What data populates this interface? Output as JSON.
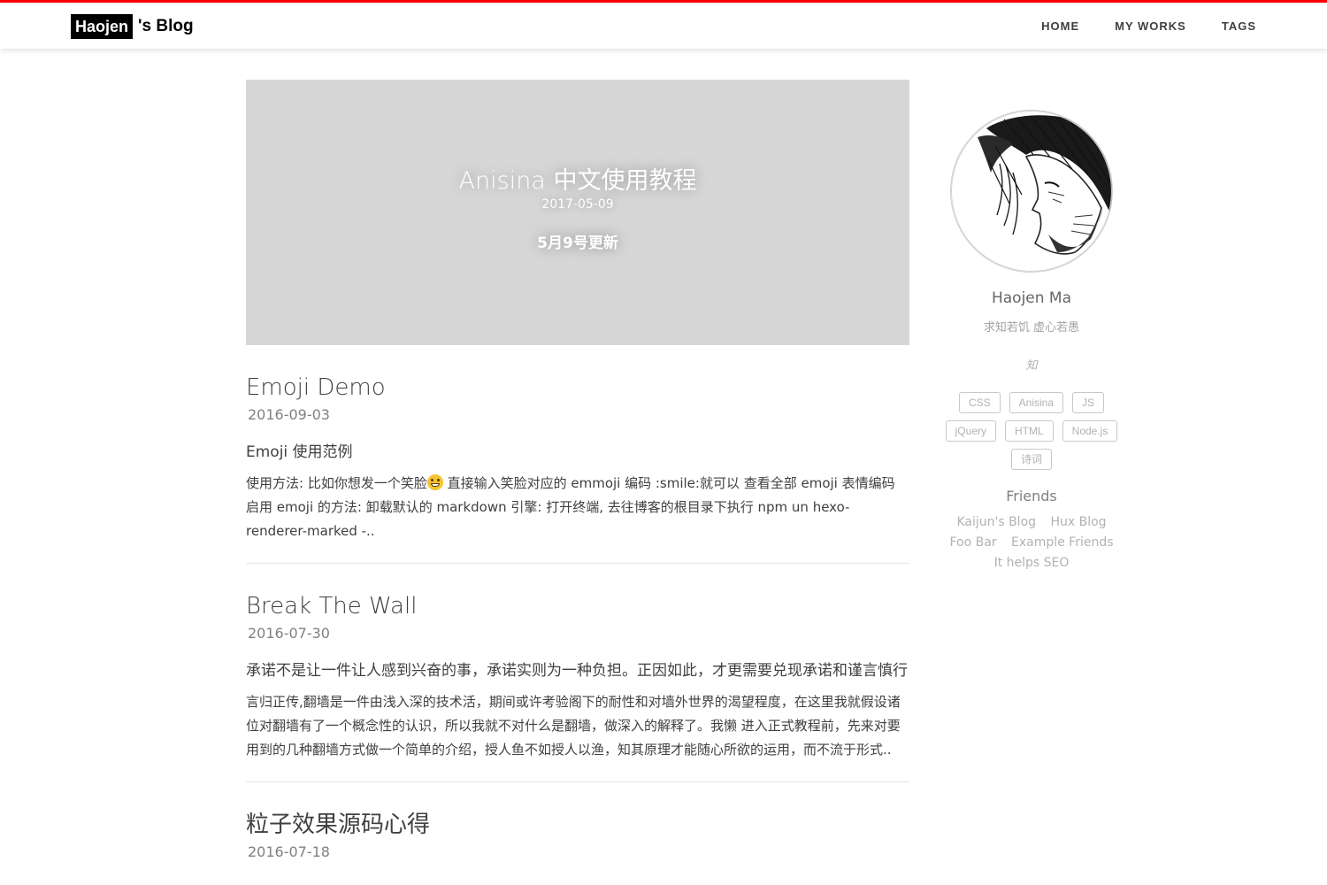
{
  "navbar": {
    "brand_name": "Haojen",
    "brand_suffix": "'s Blog",
    "accent_color": "#f90000",
    "links": [
      {
        "label": "HOME"
      },
      {
        "label": "MY WORKS"
      },
      {
        "label": "TAGS"
      }
    ]
  },
  "featured": {
    "title": "Anisina 中文使用教程",
    "date": "2017-05-09",
    "subtitle": "5月9号更新",
    "background_color": "#d6d6d6"
  },
  "posts": [
    {
      "title": "Emoji Demo",
      "date": "2016-09-03",
      "subtitle": "Emoji 使用范例",
      "excerpt_before_emoji": "使用方法: 比如你想发一个笑脸",
      "emoji_icon": "smile-emoji-icon",
      "excerpt_after_emoji": " 直接输入笑脸对应的 emmoji 编码 :smile:就可以 查看全部 emoji 表情编码 启用 emoji 的方法: 卸载默认的 markdown 引擎: 打开终端, 去往博客的根目录下执行 npm un hexo-renderer-marked -.."
    },
    {
      "title": "Break The Wall",
      "date": "2016-07-30",
      "subtitle": "承诺不是让一件让人感到兴奋的事，承诺实则为一种负担。正因如此，才更需要兑现承诺和谨言慎行",
      "excerpt": "言归正传,翻墙是一件由浅入深的技术活，期间或许考验阁下的耐性和对墙外世界的渴望程度，在这里我就假设诸位对翻墙有了一个概念性的认识，所以我就不对什么是翻墙，做深入的解释了。我懒 进入正式教程前，先来对要用到的几种翻墙方式做一个简单的介绍，授人鱼不如授人以渔，知其原理才能随心所欲的运用，而不流于形式.."
    },
    {
      "title": "粒子效果源码心得",
      "date": "2016-07-18"
    }
  ],
  "sidebar": {
    "avatar_icon": "avatar-portrait-icon",
    "name": "Haojen Ma",
    "description": "求知若饥 虚心若愚",
    "zhihu_label": "知",
    "tags": [
      "CSS",
      "Anisina",
      "JS",
      "jQuery",
      "HTML",
      "Node.js",
      "诗词"
    ],
    "friends_title": "Friends",
    "friends": [
      "Kaijun's Blog",
      "Hux Blog",
      "Foo Bar",
      "Example Friends",
      "It helps SEO"
    ]
  }
}
